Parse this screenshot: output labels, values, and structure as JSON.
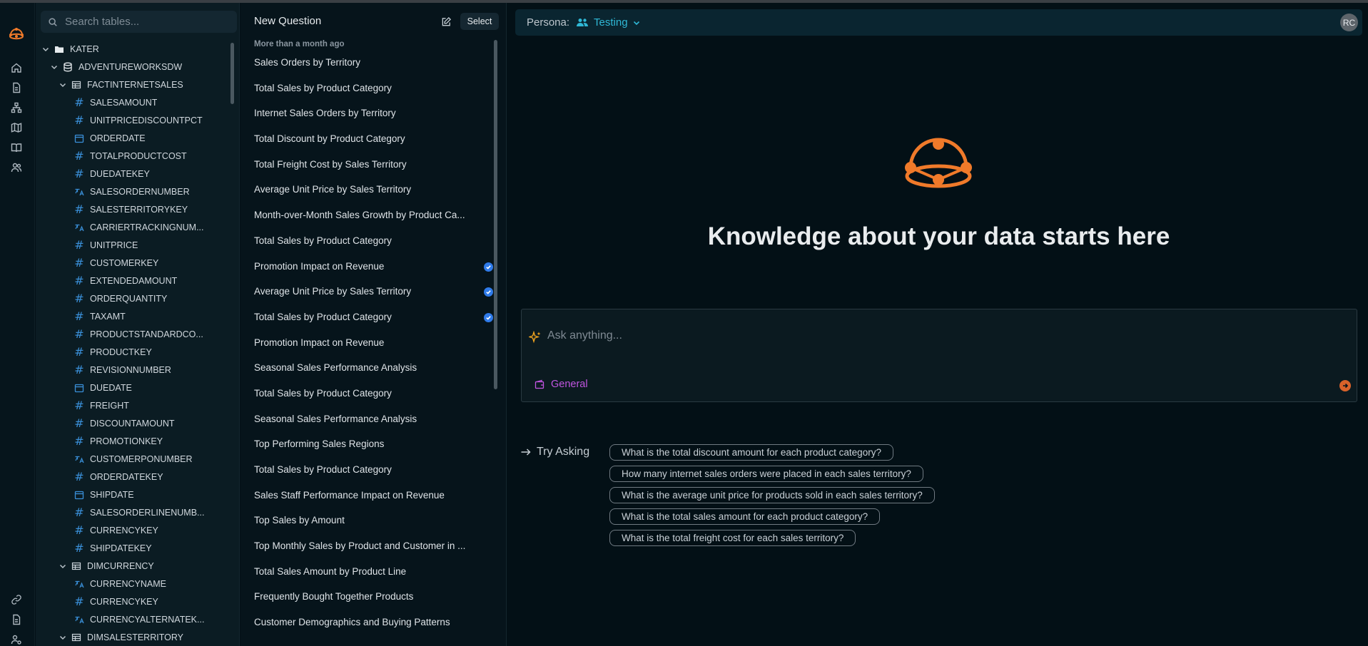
{
  "sidebar": {
    "nav_icons": [
      "logo-icon",
      "home-icon",
      "document-icon",
      "hierarchy-icon",
      "map-icon",
      "book-icon",
      "users-icon"
    ],
    "bottom_icons": [
      "link-icon",
      "file-icon",
      "user-settings-icon"
    ]
  },
  "tree": {
    "search_placeholder": "Search tables...",
    "rows": [
      {
        "label": "KATER",
        "type": "folder",
        "level": 0
      },
      {
        "label": "ADVENTUREWORKSDW",
        "type": "database",
        "level": 1
      },
      {
        "label": "FACTINTERNETSALES",
        "type": "table",
        "level": 2
      },
      {
        "label": "SALESAMOUNT",
        "type": "number",
        "level": 3
      },
      {
        "label": "UNITPRICEDISCOUNTPCT",
        "type": "number",
        "level": 3
      },
      {
        "label": "ORDERDATE",
        "type": "date",
        "level": 3
      },
      {
        "label": "TOTALPRODUCTCOST",
        "type": "number",
        "level": 3
      },
      {
        "label": "DUEDATEKEY",
        "type": "number",
        "level": 3
      },
      {
        "label": "SALESORDERNUMBER",
        "type": "text",
        "level": 3
      },
      {
        "label": "SALESTERRITORYKEY",
        "type": "number",
        "level": 3
      },
      {
        "label": "CARRIERTRACKINGNUM...",
        "type": "text",
        "level": 3
      },
      {
        "label": "UNITPRICE",
        "type": "number",
        "level": 3
      },
      {
        "label": "CUSTOMERKEY",
        "type": "number",
        "level": 3
      },
      {
        "label": "EXTENDEDAMOUNT",
        "type": "number",
        "level": 3
      },
      {
        "label": "ORDERQUANTITY",
        "type": "number",
        "level": 3
      },
      {
        "label": "TAXAMT",
        "type": "number",
        "level": 3
      },
      {
        "label": "PRODUCTSTANDARDCO...",
        "type": "number",
        "level": 3
      },
      {
        "label": "PRODUCTKEY",
        "type": "number",
        "level": 3
      },
      {
        "label": "REVISIONNUMBER",
        "type": "number",
        "level": 3
      },
      {
        "label": "DUEDATE",
        "type": "date",
        "level": 3
      },
      {
        "label": "FREIGHT",
        "type": "number",
        "level": 3
      },
      {
        "label": "DISCOUNTAMOUNT",
        "type": "number",
        "level": 3
      },
      {
        "label": "PROMOTIONKEY",
        "type": "number",
        "level": 3
      },
      {
        "label": "CUSTOMERPONUMBER",
        "type": "text",
        "level": 3
      },
      {
        "label": "ORDERDATEKEY",
        "type": "number",
        "level": 3
      },
      {
        "label": "SHIPDATE",
        "type": "date",
        "level": 3
      },
      {
        "label": "SALESORDERLINENUMB...",
        "type": "number",
        "level": 3
      },
      {
        "label": "CURRENCYKEY",
        "type": "number",
        "level": 3
      },
      {
        "label": "SHIPDATEKEY",
        "type": "number",
        "level": 3
      },
      {
        "label": "DIMCURRENCY",
        "type": "table",
        "level": 2
      },
      {
        "label": "CURRENCYNAME",
        "type": "text",
        "level": 3
      },
      {
        "label": "CURRENCYKEY",
        "type": "number",
        "level": 3
      },
      {
        "label": "CURRENCYALTERNATEK...",
        "type": "text",
        "level": 3
      },
      {
        "label": "DIMSALESTERRITORY",
        "type": "table",
        "level": 2
      }
    ]
  },
  "questions": {
    "title": "New Question",
    "select_label": "Select",
    "group_label": "More than a month ago",
    "items": [
      {
        "label": "Sales Orders by Territory",
        "verified": false
      },
      {
        "label": "Total Sales by Product Category",
        "verified": false
      },
      {
        "label": "Internet Sales Orders by Territory",
        "verified": false
      },
      {
        "label": "Total Discount by Product Category",
        "verified": false
      },
      {
        "label": "Total Freight Cost by Sales Territory",
        "verified": false
      },
      {
        "label": "Average Unit Price by Sales Territory",
        "verified": false
      },
      {
        "label": "Month-over-Month Sales Growth by Product Ca...",
        "verified": false
      },
      {
        "label": "Total Sales by Product Category",
        "verified": false
      },
      {
        "label": "Promotion Impact on Revenue",
        "verified": true
      },
      {
        "label": "Average Unit Price by Sales Territory",
        "verified": true
      },
      {
        "label": "Total Sales by Product Category",
        "verified": true
      },
      {
        "label": "Promotion Impact on Revenue",
        "verified": false
      },
      {
        "label": "Seasonal Sales Performance Analysis",
        "verified": false
      },
      {
        "label": "Total Sales by Product Category",
        "verified": false
      },
      {
        "label": "Seasonal Sales Performance Analysis",
        "verified": false
      },
      {
        "label": "Top Performing Sales Regions",
        "verified": false
      },
      {
        "label": "Total Sales by Product Category",
        "verified": false
      },
      {
        "label": "Sales Staff Performance Impact on Revenue",
        "verified": false
      },
      {
        "label": "Top Sales by Amount",
        "verified": false
      },
      {
        "label": "Top Monthly Sales by Product and Customer in ...",
        "verified": false
      },
      {
        "label": "Total Sales Amount by Product Line",
        "verified": false
      },
      {
        "label": "Frequently Bought Together Products",
        "verified": false
      },
      {
        "label": "Customer Demographics and Buying Patterns",
        "verified": false
      }
    ]
  },
  "main": {
    "persona_label": "Persona:",
    "persona_value": "Testing",
    "avatar_initials": "RC",
    "headline": "Knowledge about your data starts here",
    "ask_placeholder": "Ask anything...",
    "context_label": "General",
    "try_label": "Try Asking",
    "suggestions": [
      "What is the total discount amount for each product category?",
      "How many internet sales orders were placed in each sales territory?",
      "What is the average unit price for products sold in each sales territory?",
      "What is the total sales amount for each product category?",
      "What is the total freight cost for each sales territory?"
    ]
  },
  "colors": {
    "accent_orange": "#f07a2a",
    "persona_cyan": "#2fb8d6",
    "context_purple": "#c055e0",
    "verified_blue": "#2f7bea"
  }
}
